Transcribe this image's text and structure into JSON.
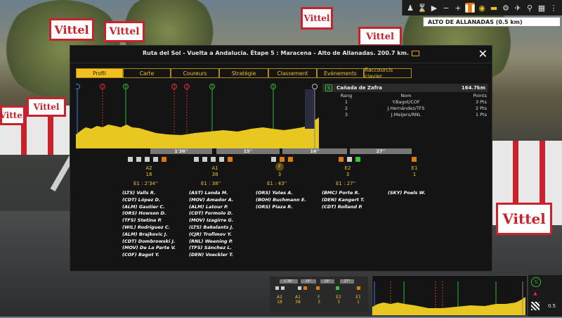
{
  "background": {
    "banners": [
      "Vittel",
      "Vittel",
      "Vittel",
      "Vittel",
      "Vittel",
      "Vittel",
      "Vittel"
    ]
  },
  "hud": {
    "buttons": [
      "leader-icon",
      "hourglass-icon",
      "play-icon",
      "minus-icon",
      "plus-icon",
      "pause-icon",
      "eye-icon",
      "car-icon",
      "motorbike-icon",
      "helicopter-icon",
      "bike-icon",
      "grid-icon",
      "menu-icon"
    ],
    "climb_label": "ALTO DE ALLANADAS (0.5 km)"
  },
  "panel": {
    "title": "Ruta del Sol - Vuelta a Andalucia. Étape 5 : Maracena - Alto de Allanadas. 200.7 km.",
    "tabs": [
      {
        "label": "Profil",
        "active": true
      },
      {
        "label": "Carte",
        "active": false
      },
      {
        "label": "Coureurs",
        "active": false
      },
      {
        "label": "Stratégie",
        "active": false
      },
      {
        "label": "Classement",
        "active": false
      },
      {
        "label": "Evénements",
        "active": false
      },
      {
        "label": "Raccourcis clavier",
        "active": false
      }
    ]
  },
  "profile_markers": [
    {
      "kind": "start",
      "label": "▸",
      "color": "#4a7fe0"
    },
    {
      "kind": "climb",
      "label": "3",
      "color": "#d83030"
    },
    {
      "kind": "sprint",
      "label": "S",
      "color": "#33b833"
    },
    {
      "kind": "climb",
      "label": "3",
      "color": "#d83030"
    },
    {
      "kind": "climb",
      "label": "3",
      "color": "#d83030"
    },
    {
      "kind": "sprint",
      "label": "S",
      "color": "#33b833"
    },
    {
      "kind": "sprint",
      "label": "S",
      "color": "#33b833"
    },
    {
      "kind": "finish",
      "label": "",
      "color": "#bbbbbb"
    }
  ],
  "sprint": {
    "name": "Cañada de Zafra",
    "km": "164.7km",
    "icon": "S",
    "headers": [
      "Rang",
      "Nom",
      "Points"
    ],
    "rows": [
      {
        "rank": "1",
        "name": "Y.Bagot/COF",
        "points": "3 Pts"
      },
      {
        "rank": "2",
        "name": "J.Hernández/TFS",
        "points": "2 Pts"
      },
      {
        "rank": "3",
        "name": "J.Meijers/RNL",
        "points": "1 Pts"
      }
    ]
  },
  "gaps": [
    "1'36''",
    "15''",
    "16''",
    "27''"
  ],
  "groups": [
    {
      "label": "A2",
      "count": "18",
      "time": "E1 : 2'34''",
      "badge": "",
      "riders": [
        "(LTS) Valls R.",
        "(CDT) López D.",
        "(ALM) Gautier C.",
        "(ORS) Howson D.",
        "(TFS) Stetina P.",
        "(WIL) Rodriguez C.",
        "(ALM) Brajkovic J.",
        "(CDT) Dombrowski J.",
        "(MOV) De La Parte V.",
        "(COF) Bagot Y."
      ]
    },
    {
      "label": "A1",
      "count": "38",
      "time": "E1 : 38''",
      "badge": "",
      "riders": [
        "(AST) Landa M.",
        "(MOV) Amador A.",
        "(ALM) Latour P.",
        "(CDT) Formolo D.",
        "(MOV) Izagirre G.",
        "(LTS) Bakelants J.",
        "(CJR) Trofimov Y.",
        "(RNL) Weening P.",
        "(TFS) Sánchez L.",
        "(DEN) Voeckler T."
      ]
    },
    {
      "label": "F",
      "count": "3",
      "time": "E1 : 43''",
      "badge": "F",
      "riders": [
        "(ORS) Yates A.",
        "(BOH) Buchmann E.",
        "(ORS) Piaza R."
      ]
    },
    {
      "label": "E2",
      "count": "3",
      "time": "E1 : 27''",
      "badge": "",
      "riders": [
        "(BMC) Porte R.",
        "(DEN) Kangert T.",
        "(CDT) Rolland P."
      ]
    },
    {
      "label": "E1",
      "count": "1",
      "time": "",
      "badge": "",
      "riders": [
        "(SKY) Poels W."
      ]
    }
  ],
  "mini": {
    "gaps": [
      "1'36''",
      "15''",
      "16''",
      "27''"
    ],
    "labels": [
      "A2",
      "A1",
      "F",
      "E2",
      "E1"
    ],
    "counts": [
      "18",
      "38",
      "3",
      "3",
      "1"
    ],
    "speed": "0.5"
  }
}
